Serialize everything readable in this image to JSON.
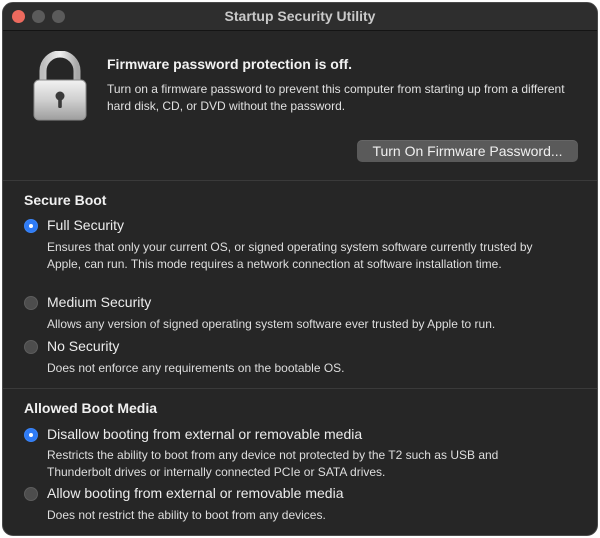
{
  "window": {
    "title": "Startup Security Utility"
  },
  "firmware": {
    "heading": "Firmware password protection is off.",
    "description": "Turn on a firmware password to prevent this computer from starting up from a different hard disk, CD, or DVD without the password.",
    "button_label": "Turn On Firmware Password...",
    "icon": "lock-icon"
  },
  "secure_boot": {
    "title": "Secure Boot",
    "options": [
      {
        "label": "Full Security",
        "selected": true,
        "description": "Ensures that only your current OS, or signed operating system software currently trusted by Apple, can run. This mode requires a network connection at software installation time."
      },
      {
        "label": "Medium Security",
        "selected": false,
        "description": "Allows any version of signed operating system software ever trusted by Apple to run."
      },
      {
        "label": "No Security",
        "selected": false,
        "description": "Does not enforce any requirements on the bootable OS."
      }
    ]
  },
  "boot_media": {
    "title": "Allowed Boot Media",
    "options": [
      {
        "label": "Disallow booting from external or removable media",
        "selected": true,
        "description": "Restricts the ability to boot from any device not protected by the T2 such as USB and Thunderbolt drives or internally connected PCIe or SATA drives."
      },
      {
        "label": "Allow booting from external or removable media",
        "selected": false,
        "description": "Does not restrict the ability to boot from any devices."
      }
    ]
  },
  "colors": {
    "accent": "#2f7bf5",
    "window_bg": "#262626",
    "button_bg": "#5a5a5a"
  }
}
